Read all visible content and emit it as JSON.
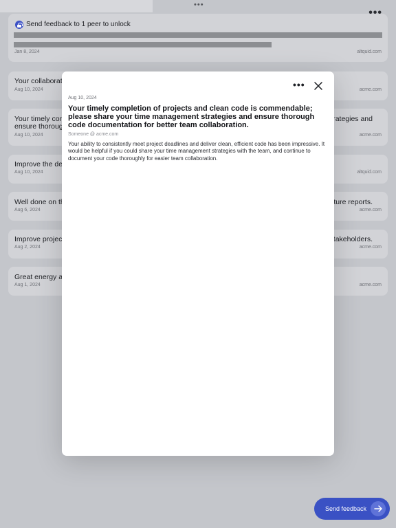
{
  "header": {
    "more_icon": "more-horizontal-icon"
  },
  "locked_card": {
    "message": "Send feedback to 1 peer to unlock",
    "date": "Jan 8, 2024",
    "domain": "altquid.com"
  },
  "feedback_list": [
    {
      "title": "Your collaboratio",
      "title_right": "",
      "date": "Aug 10, 2024",
      "domain": "acme.com"
    },
    {
      "title": "Your timely com",
      "title_line2": "ensure thorough",
      "title_right": "trategies and",
      "date": "Aug 10, 2024",
      "domain": "acme.com"
    },
    {
      "title": "Improve the det",
      "title_right": "",
      "date": "Aug 10, 2024",
      "domain": "altquid.com"
    },
    {
      "title": "Well done on the",
      "title_right": "future reports.",
      "date": "Aug 6, 2024",
      "domain": "acme.com"
    },
    {
      "title": "Improve project",
      "title_right": "stakeholders.",
      "date": "Aug 2, 2024",
      "domain": "acme.com"
    },
    {
      "title": "Great energy an",
      "title_right": "",
      "date": "Aug 1, 2024",
      "domain": "acme.com"
    }
  ],
  "modal": {
    "date": "Aug 10, 2024",
    "title": "Your timely completion of projects and clean code is commendable; please share your time management strategies and ensure thorough code documentation for better team collaboration.",
    "author": "Someone @ acme.com",
    "body": "Your ability to consistently meet project deadlines and deliver clean, efficient code has been impressive. It would be helpful if you could share your time management strategies with the team, and continue to document your code thoroughly for easier team collaboration."
  },
  "send_button": {
    "label": "Send feedback",
    "icon": "arrow-right-icon"
  },
  "colors": {
    "accent": "#3a51c4",
    "backdrop": "#c4c6cb"
  }
}
